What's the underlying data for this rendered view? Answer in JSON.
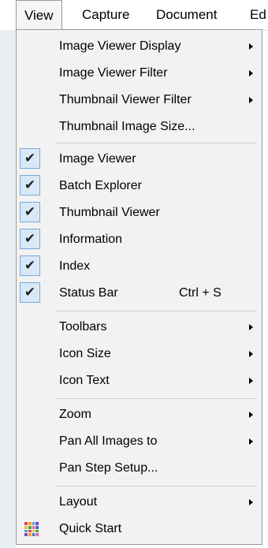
{
  "menubar": {
    "items": [
      "View",
      "Capture",
      "Document",
      "Ed"
    ],
    "active": "View"
  },
  "menu": {
    "items": [
      {
        "label": "Image Viewer Display",
        "submenu": true
      },
      {
        "label": "Image Viewer Filter",
        "submenu": true
      },
      {
        "label": "Thumbnail Viewer Filter",
        "submenu": true
      },
      {
        "label": "Thumbnail Image Size...",
        "submenu": false
      },
      {
        "label": "Image Viewer",
        "checked": true
      },
      {
        "label": "Batch Explorer",
        "checked": true
      },
      {
        "label": "Thumbnail Viewer",
        "checked": true
      },
      {
        "label": "Information",
        "checked": true
      },
      {
        "label": "Index",
        "checked": true
      },
      {
        "label": "Status Bar",
        "checked": true,
        "shortcut": "Ctrl + S"
      },
      {
        "label": "Toolbars",
        "submenu": true
      },
      {
        "label": "Icon Size",
        "submenu": true
      },
      {
        "label": "Icon Text",
        "submenu": true
      },
      {
        "label": "Zoom",
        "submenu": true
      },
      {
        "label": "Pan All Images to",
        "submenu": true
      },
      {
        "label": "Pan Step Setup...",
        "submenu": false
      },
      {
        "label": "Layout",
        "submenu": true
      },
      {
        "label": "Quick Start",
        "icon": "quick-start-icon"
      }
    ],
    "check_glyph": "✔"
  },
  "colors": {
    "menu_bg": "#f2f2f2",
    "check_bg": "#d9e8f7",
    "check_border": "#77a9dd"
  }
}
